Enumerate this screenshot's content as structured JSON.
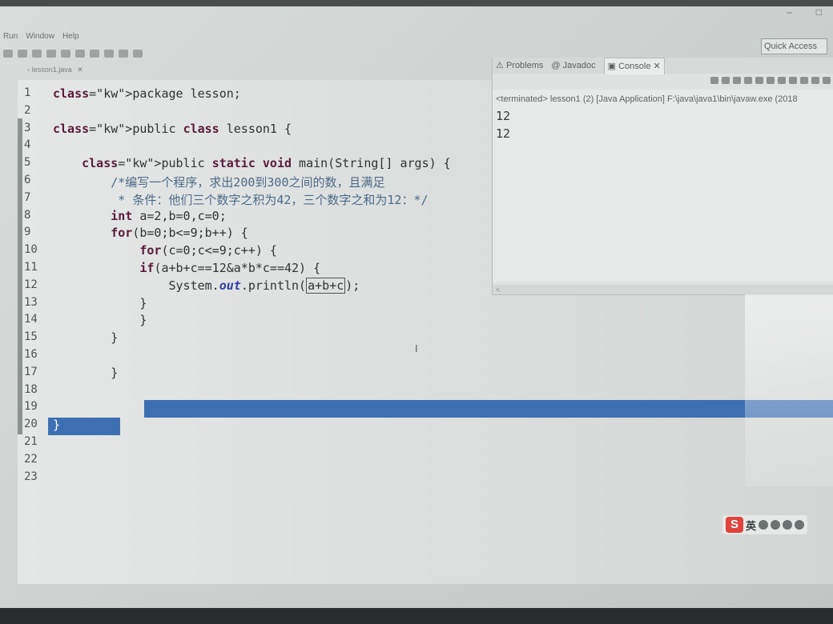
{
  "menu": [
    "Run",
    "Window",
    "Help"
  ],
  "window_controls": [
    "–",
    "□"
  ],
  "quick_access": "Quick Access",
  "editor_tab": {
    "label": "lesson1.java",
    "close": "✕"
  },
  "code_lines": [
    {
      "n": "1",
      "text": "package lesson;"
    },
    {
      "n": "2",
      "text": ""
    },
    {
      "n": "3",
      "text": "public class lesson1 {"
    },
    {
      "n": "4",
      "text": ""
    },
    {
      "n": "5",
      "text": "    public static void main(String[] args) {"
    },
    {
      "n": "6",
      "text": "        /*编写一个程序，求出200到300之间的数，且满足"
    },
    {
      "n": "7",
      "text": "         * 条件：他们三个数字之积为42，三个数字之和为12：*/"
    },
    {
      "n": "8",
      "text": "        int a=2,b=0,c=0;"
    },
    {
      "n": "9",
      "text": "        for(b=0;b<=9;b++) {"
    },
    {
      "n": "10",
      "text": "            for(c=0;c<=9;c++) {"
    },
    {
      "n": "11",
      "text": "            if(a+b+c==12&a*b*c==42) {"
    },
    {
      "n": "12",
      "text": "                System.out.println(a+b+c);"
    },
    {
      "n": "13",
      "text": "            }"
    },
    {
      "n": "14",
      "text": "            }"
    },
    {
      "n": "15",
      "text": "        }"
    },
    {
      "n": "16",
      "text": ""
    },
    {
      "n": "17",
      "text": "        }"
    },
    {
      "n": "18",
      "text": ""
    },
    {
      "n": "19",
      "text": ""
    },
    {
      "n": "20",
      "text": "}"
    },
    {
      "n": "21",
      "text": ""
    },
    {
      "n": "22",
      "text": ""
    },
    {
      "n": "23",
      "text": ""
    }
  ],
  "console": {
    "tabs": [
      "Problems",
      "Javadoc",
      "Console"
    ],
    "active_tab": "Console",
    "close": "✕",
    "terminated": "<terminated> lesson1 (2) [Java Application] F:\\java\\java1\\bin\\javaw.exe (2018",
    "output": [
      "12",
      "12"
    ]
  },
  "ime": {
    "logo": "S",
    "mode": "英"
  }
}
